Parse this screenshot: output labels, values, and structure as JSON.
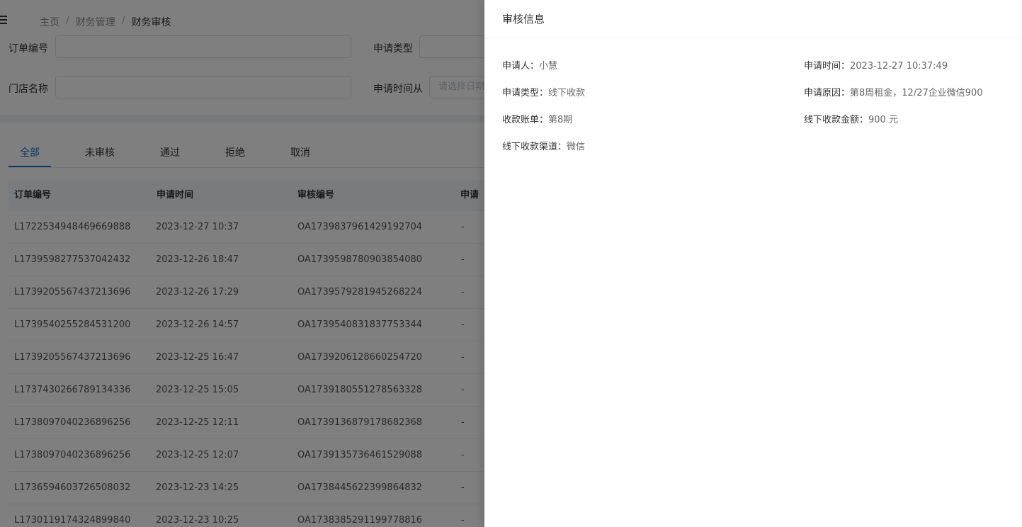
{
  "breadcrumb": {
    "home": "主页",
    "sep": "/",
    "level1": "财务管理",
    "current": "财务审核"
  },
  "filters": {
    "order_no_label": "订单编号",
    "apply_type_label": "申请类型",
    "store_name_label": "门店名称",
    "apply_time_from_label": "申请时间从",
    "date_placeholder": "请选择日期"
  },
  "tabs": [
    "全部",
    "未审核",
    "通过",
    "拒绝",
    "取消"
  ],
  "table": {
    "headers": [
      "订单编号",
      "申请时间",
      "审核编号",
      "申请"
    ],
    "rows": [
      [
        "L1722534948469669888",
        "2023-12-27 10:37",
        "OA1739837961429192704",
        "-"
      ],
      [
        "L1739598277537042432",
        "2023-12-26 18:47",
        "OA1739598780903854080",
        "-"
      ],
      [
        "L1739205567437213696",
        "2023-12-26 17:29",
        "OA1739579281945268224",
        "-"
      ],
      [
        "L1739540255284531200",
        "2023-12-26 14:57",
        "OA1739540831837753344",
        "-"
      ],
      [
        "L1739205567437213696",
        "2023-12-25 16:47",
        "OA1739206128660254720",
        "-"
      ],
      [
        "L1737430266789134336",
        "2023-12-25 15:05",
        "OA1739180551278563328",
        "-"
      ],
      [
        "L1738097040236896256",
        "2023-12-25 12:11",
        "OA1739136879178682368",
        "-"
      ],
      [
        "L1738097040236896256",
        "2023-12-25 12:07",
        "OA1739135736461529088",
        "-"
      ],
      [
        "L1736594603726508032",
        "2023-12-23 14:25",
        "OA1738445622399864832",
        "-"
      ],
      [
        "L1730119174324899840",
        "2023-12-23 10:25",
        "OA1738385291199778816",
        "-"
      ]
    ]
  },
  "drawer": {
    "title": "审核信息",
    "applicant_label": "申请人：",
    "applicant": "小慧",
    "apply_time_label": "申请时间：",
    "apply_time": "2023-12-27 10:37:49",
    "apply_type_label": "申请类型：",
    "apply_type": "线下收款",
    "apply_reason_label": "申请原因：",
    "apply_reason": "第8周租金，12/27企业微信900",
    "bill_label": "收款账单：",
    "bill": "第8期",
    "amount_label": "线下收款金额：",
    "amount": "900 元",
    "channel_label": "线下收款渠道：",
    "channel": "微信"
  }
}
